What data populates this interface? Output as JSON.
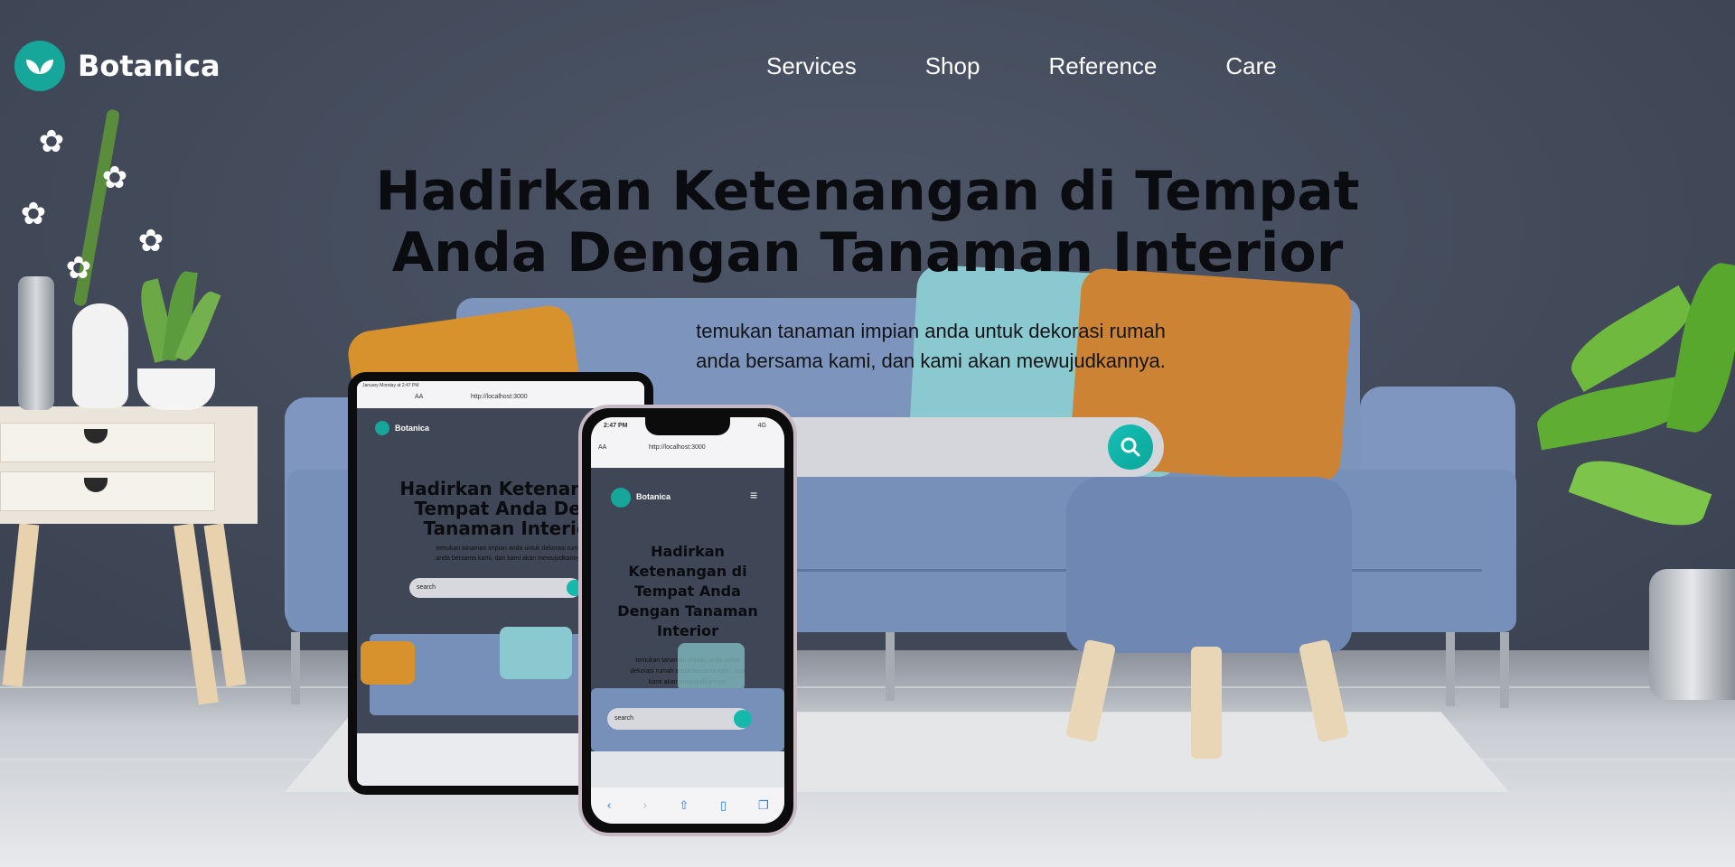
{
  "app": {
    "brand": "Botanica"
  },
  "nav": {
    "items": [
      "Services",
      "Shop",
      "Reference",
      "Care"
    ]
  },
  "hero": {
    "title_line1": "Hadirkan Ketenangan di Tempat",
    "title_line2": "Anda Dengan Tanaman Interior",
    "subtitle_line1": "temukan tanaman impian anda untuk dekorasi rumah",
    "subtitle_line2": "anda bersama kami, dan kami akan mewujudkannya."
  },
  "search": {
    "placeholder": "",
    "icon": "search-icon"
  },
  "tablet_preview": {
    "status_left": "January Monday at 2:47 PM",
    "address_prefix": "AA",
    "url": "http://localhost:3000",
    "brand": "Botanica",
    "title_line1": "Hadirkan Ketenangan",
    "title_line2": "Tempat Anda Deng",
    "title_line3": "Tanaman Interior",
    "sub_line1": "temukan tanaman impian anda untuk dekorasi rumah",
    "sub_line2": "anda bersama kami, dan kami akan mewujudkannya.",
    "search_text": "search"
  },
  "phone_preview": {
    "time": "2:47 PM",
    "network": "4G",
    "address_prefix": "AA",
    "url": "http://localhost:3000",
    "brand": "Botanica",
    "title_line1": "Hadirkan",
    "title_line2": "Ketenangan di",
    "title_line3": "Tempat Anda",
    "title_line4": "Dengan Tanaman",
    "title_line5": "Interior",
    "sub_line1": "temukan tanaman impian anda untuk",
    "sub_line2": "dekorasi rumah anda bersama kami, dan",
    "sub_line3": "kami akan mewujudkannya.",
    "search_text": "search",
    "tabbar_icons": [
      "back-icon",
      "forward-icon",
      "share-icon",
      "bookmarks-icon",
      "tabs-icon"
    ]
  },
  "colors": {
    "brand_teal": "#16a69a",
    "search_gradient_start": "#17c0b5",
    "wall": "#434b5b",
    "sofa": "#7790ba"
  }
}
